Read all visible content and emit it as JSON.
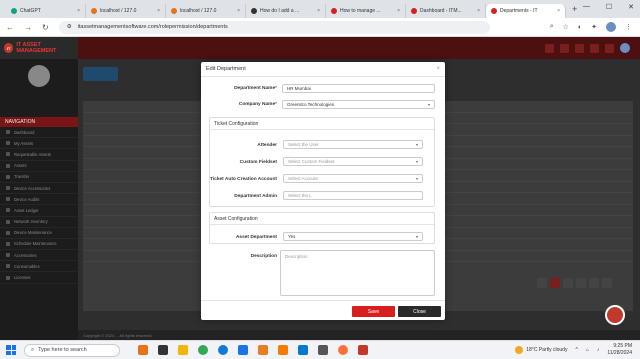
{
  "browser": {
    "tabs": [
      {
        "title": "ChatGPT",
        "color": "#10a37f"
      },
      {
        "title": "localhost / 127.0",
        "color": "#e8711c"
      },
      {
        "title": "localhost / 127.0",
        "color": "#e8711c"
      },
      {
        "title": "How do I add a ...",
        "color": "#333333"
      },
      {
        "title": "How to manage ...",
        "color": "#d71f1f"
      },
      {
        "title": "Dashboard - ITM...",
        "color": "#d71f1f"
      },
      {
        "title": "Departments - IT",
        "color": "#d71f1f"
      }
    ],
    "new_tab": "+",
    "url": "itassetmanagementsoftware.com/rolepermission/departments"
  },
  "app": {
    "logo_text": "IT ASSET MANAGEMENT",
    "sidebar_header": "NAVIGATION",
    "sidebar_items": [
      "Dashboard",
      "My Assets",
      "Requestable Assets",
      "Assets",
      "Transfer",
      "Device Accessories",
      "Device Audits",
      "Asset Ledger",
      "Network Inventory",
      "Device Maintenance",
      "Schedule Maintenance",
      "Accessories",
      "Consumables",
      "Licenses"
    ],
    "footer": "Copyright © 2024 ... All rights reserved."
  },
  "modal": {
    "title": "Edit Department",
    "close_icon": "×",
    "department_name": {
      "label": "Department Name",
      "value": "HR Mumbai"
    },
    "company_name": {
      "label": "Company Name",
      "value": "Greenitco Technologies"
    },
    "ticket_section": "Ticket Configuration",
    "attender": {
      "label": "Attender",
      "placeholder": "Select the User"
    },
    "custom_fieldset": {
      "label": "Custom Fieldset",
      "placeholder": "Select Custom Fieldset"
    },
    "ticket_auto": {
      "label": "Ticket Auto Creation Account",
      "placeholder": "Select Account"
    },
    "department_admin": {
      "label": "Department Admin",
      "placeholder": "Select the L"
    },
    "asset_section": "Asset Configuration",
    "asset_department": {
      "label": "Asset Department",
      "value": "Yes"
    },
    "description": {
      "label": "Description",
      "placeholder": "Description"
    },
    "save": "Save",
    "close": "Close"
  },
  "taskbar": {
    "search": "Type here to search",
    "weather": "18°C  Partly cloudy",
    "time": "9:25 PM",
    "date": "11/28/2024"
  }
}
